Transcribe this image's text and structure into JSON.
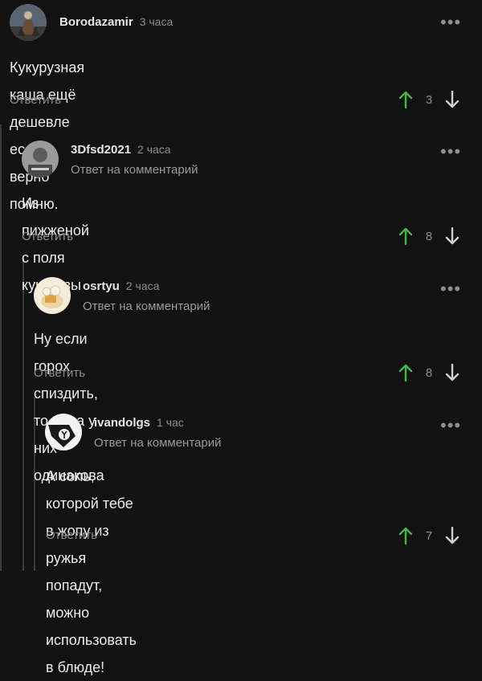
{
  "colors": {
    "background": "#121212",
    "upvote": "#4caf50",
    "muted": "#8e8e8e"
  },
  "comments": [
    {
      "username": "Borodazamir",
      "time": "3 часа",
      "reply_to": "",
      "text": "Кукурузная каша ещё дешевле если верно помню.",
      "reply_label": "Ответить",
      "score": "3",
      "avatar_icon": "warrior-avatar"
    },
    {
      "username": "3Dfsd2021",
      "time": "2 часа",
      "reply_to": "Ответ на комментарий",
      "text": "Из пижженой с поля кукурузы",
      "reply_label": "Ответить",
      "score": "8",
      "avatar_icon": "portrait-avatar"
    },
    {
      "username": "osrtyu",
      "time": "2 часа",
      "reply_to": "Ответ на комментарий",
      "text": "Ну если горох спиздить, то цена у них одинакова",
      "reply_label": "Ответить",
      "score": "8",
      "avatar_icon": "cartoon-avatar"
    },
    {
      "username": "ivandolgs",
      "time": "1 час",
      "reply_to": "Ответ на комментарий",
      "text_line1": "А соль, которой тебе в жопу из ружья попадут, можно",
      "text_line2": "использовать в блюде!",
      "reply_label": "Ответить",
      "score": "7",
      "avatar_icon": "half-life-logo-avatar"
    }
  ]
}
